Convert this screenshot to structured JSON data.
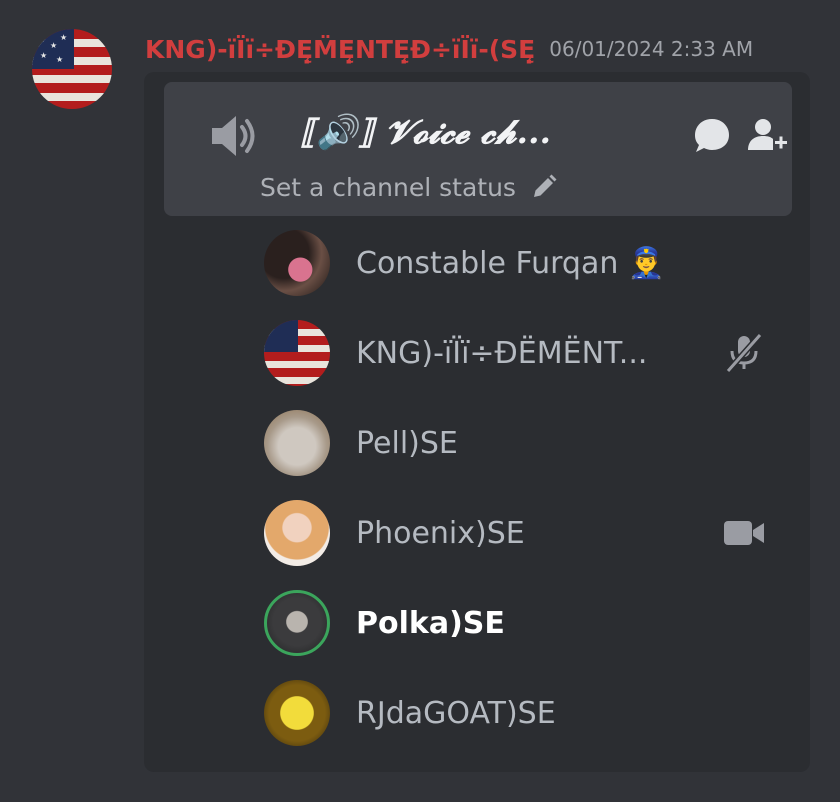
{
  "message": {
    "author": "KNG)-ïÏï÷ĐĘ̣M̈Ę̣NTĘ̣Đ÷ïÏï-(SĘ̣",
    "timestamp": "06/01/2024 2:33 AM"
  },
  "voice_channel": {
    "name": "⟦🔊⟧ 𝓥𝓸𝓲𝓬𝓮 𝓬𝓱...",
    "status_placeholder": "Set a channel status"
  },
  "members": [
    {
      "name": "Constable Furqan 👮‍♂️",
      "avatar": "furqan",
      "right_icon": null,
      "speaking": false
    },
    {
      "name": "KNG)-ïÏï÷ĐËMËNT...",
      "avatar": "flag",
      "right_icon": "muted-mic-icon",
      "speaking": false
    },
    {
      "name": "Pell)SE",
      "avatar": "cat",
      "right_icon": null,
      "speaking": false
    },
    {
      "name": "Phoenix)SE",
      "avatar": "phoenix",
      "right_icon": "video-camera-icon",
      "speaking": false
    },
    {
      "name": "Polka)SE",
      "avatar": "polka",
      "right_icon": null,
      "speaking": true
    },
    {
      "name": "RJdaGOAT)SE",
      "avatar": "sponge",
      "right_icon": null,
      "speaking": false
    }
  ],
  "colors": {
    "background": "#313338",
    "embed": "#2b2d31",
    "channel_box": "#3f4147",
    "author_name": "#d13e3e",
    "speaking_ring": "#3ba55c"
  }
}
